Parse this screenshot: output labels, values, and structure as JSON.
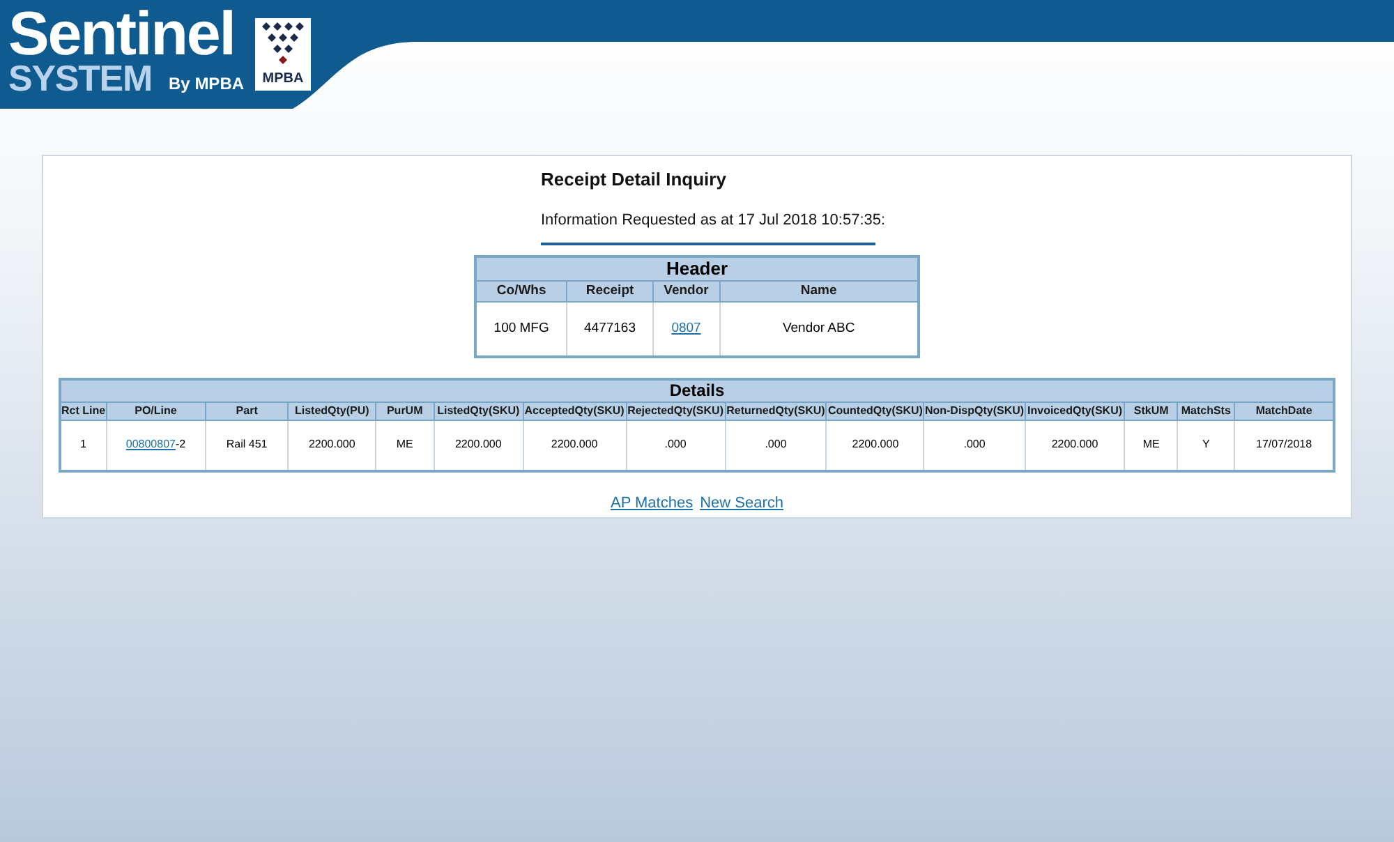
{
  "logo": {
    "title": "Sentinel",
    "subtitle": "SYSTEM",
    "byline": "By MPBA",
    "badge": "MPBA"
  },
  "page": {
    "title": "Receipt Detail Inquiry",
    "requested": "Information Requested as at 17 Jul 2018 10:57:35:"
  },
  "header_table": {
    "title": "Header",
    "columns": [
      "Co/Whs",
      "Receipt",
      "Vendor",
      "Name"
    ],
    "rows": [
      [
        {
          "text": "100 MFG"
        },
        {
          "text": "4477163"
        },
        {
          "link": "0807"
        },
        {
          "text": "Vendor ABC"
        }
      ]
    ]
  },
  "details_table": {
    "title": "Details",
    "columns": [
      "Rct Line",
      "PO/Line",
      "Part",
      "ListedQty(PU)",
      "PurUM",
      "ListedQty(SKU)",
      "AcceptedQty(SKU)",
      "RejectedQty(SKU)",
      "ReturnedQty(SKU)",
      "CountedQty(SKU)",
      "Non-DispQty(SKU)",
      "InvoicedQty(SKU)",
      "StkUM",
      "MatchSts",
      "MatchDate"
    ],
    "rows": [
      [
        {
          "text": "1"
        },
        {
          "link": "00800807",
          "text": "-2"
        },
        {
          "text": "Rail 451"
        },
        {
          "text": "2200.000"
        },
        {
          "text": "ME"
        },
        {
          "text": "2200.000"
        },
        {
          "text": "2200.000"
        },
        {
          "text": ".000"
        },
        {
          "text": ".000"
        },
        {
          "text": "2200.000"
        },
        {
          "text": ".000"
        },
        {
          "text": "2200.000"
        },
        {
          "text": "ME"
        },
        {
          "text": "Y"
        },
        {
          "text": "17/07/2018"
        }
      ]
    ]
  },
  "links": [
    "AP Matches",
    "New Search"
  ]
}
